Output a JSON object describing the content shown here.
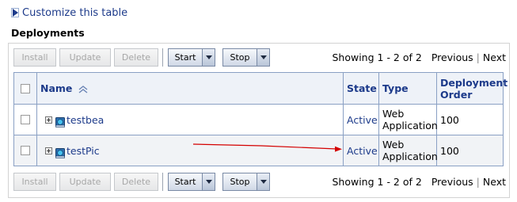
{
  "customize": {
    "label": "Customize this table",
    "icon": "triangle-right-icon"
  },
  "section": {
    "title": "Deployments"
  },
  "toolbar": {
    "install_label": "Install",
    "update_label": "Update",
    "delete_label": "Delete",
    "start_label": "Start",
    "stop_label": "Stop"
  },
  "pager": {
    "showing": "Showing 1 - 2 of 2",
    "previous": "Previous",
    "separator": "|",
    "next": "Next"
  },
  "table": {
    "headers": {
      "name": "Name",
      "state": "State",
      "type": "Type",
      "order_line1": "Deployment",
      "order_line2": "Order"
    },
    "rows": [
      {
        "name": "testbea",
        "state": "Active",
        "type_line1": "Web",
        "type_line2": "Application",
        "order": "100"
      },
      {
        "name": "testPic",
        "state": "Active",
        "type_line1": "Web",
        "type_line2": "Application",
        "order": "100"
      }
    ]
  },
  "colors": {
    "link": "#1c3a8a",
    "annotation_arrow": "#d40000",
    "header_bg": "#eef2f8"
  }
}
